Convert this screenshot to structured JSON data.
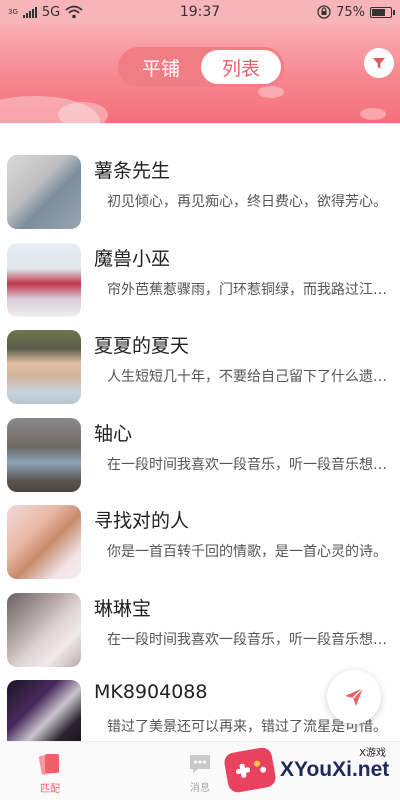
{
  "status_bar": {
    "carrier_badge": "3G",
    "network": "5G",
    "time": "19:37",
    "battery": "75%",
    "battery_level": 0.75
  },
  "header": {
    "tabs": [
      {
        "label": "平铺",
        "active": false
      },
      {
        "label": "列表",
        "active": true
      }
    ],
    "filter_icon": "filter-icon"
  },
  "users": [
    {
      "name": "薯条先生",
      "signature": "初见倾心，再见痴心，终日费心，欲得芳心。"
    },
    {
      "name": "魔兽小巫",
      "signature": "帘外芭蕉惹骤雨，门环惹铜绿，而我路过江南。"
    },
    {
      "name": "夏夏的夏天",
      "signature": "人生短短几十年，不要给自己留下了什么遗憾。"
    },
    {
      "name": "轴心",
      "signature": "在一段时间我喜欢一段音乐，听一段音乐想一个人。"
    },
    {
      "name": "寻找对的人",
      "signature": "你是一首百转千回的情歌，是一首心灵的诗。"
    },
    {
      "name": "琳琳宝",
      "signature": "在一段时间我喜欢一段音乐，听一段音乐想一个人。"
    },
    {
      "name": "MK8904088",
      "signature": "错过了美景还可以再来，错过了流星是可惜。"
    }
  ],
  "bottom_nav": [
    {
      "label": "匹配",
      "icon": "cards-icon",
      "active": true
    },
    {
      "label": "消息",
      "icon": "message-icon",
      "active": false
    }
  ],
  "watermark": {
    "small": "X游戏",
    "text": "XYouXi.net"
  },
  "colors": {
    "accent": "#f0606a",
    "header_top": "#f9b0b3",
    "header_bottom": "#f4717b"
  }
}
